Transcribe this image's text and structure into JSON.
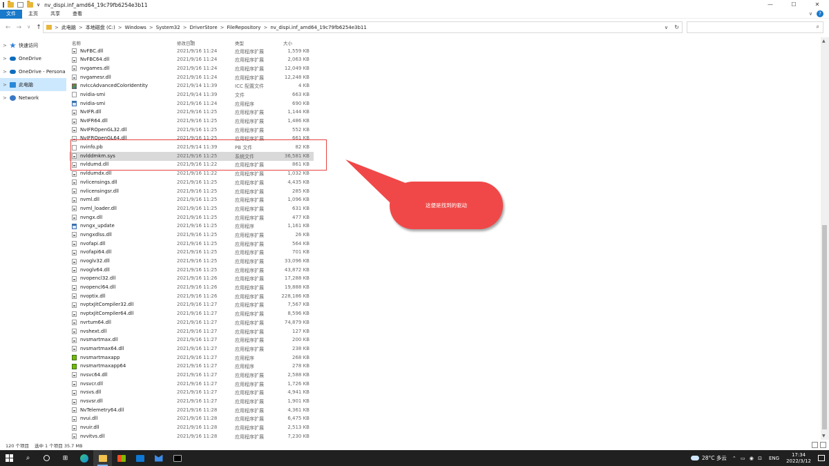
{
  "window": {
    "title": "nv_dispi.inf_amd64_19c79fb6254e3b11",
    "qa_dropdown": "∨",
    "controls": {
      "minimize": "—",
      "maximize": "☐",
      "close": "✕"
    }
  },
  "ribbon": {
    "tabs": [
      "文件",
      "主页",
      "共享",
      "查看"
    ],
    "collapse": "∨",
    "help": "?"
  },
  "nav_buttons": {
    "back": "←",
    "forward": "→",
    "recent": "∨",
    "up": "↑"
  },
  "address": {
    "crumbs": [
      "此电脑",
      "本地磁盘 (C:)",
      "Windows",
      "System32",
      "DriverStore",
      "FileRepository",
      "nv_dispi.inf_amd64_19c79fb6254e3b11"
    ],
    "separator": ">",
    "dropdown": "∨",
    "refresh": "↻"
  },
  "search": {
    "placeholder": "",
    "icon": "⌕"
  },
  "sidebar": {
    "items": [
      {
        "label": "快速访问",
        "icon": "star-icon"
      },
      {
        "label": "OneDrive",
        "icon": "cloud-icon"
      },
      {
        "label": "OneDrive - Persona",
        "icon": "cloud-icon"
      },
      {
        "label": "此电脑",
        "icon": "computer-icon",
        "selected": true
      },
      {
        "label": "Network",
        "icon": "network-icon"
      }
    ],
    "chevron": ">"
  },
  "columns": {
    "name": "名称",
    "date": "修改日期",
    "type": "类型",
    "size": "大小",
    "sort_caret": "^"
  },
  "files": [
    {
      "name": "NvFBC.dll",
      "date": "2021/9/16 11:24",
      "type": "应用程序扩展",
      "size": "1,559 KB",
      "icon": "dll"
    },
    {
      "name": "NvFBC64.dll",
      "date": "2021/9/16 11:24",
      "type": "应用程序扩展",
      "size": "2,063 KB",
      "icon": "dll"
    },
    {
      "name": "nvgames.dll",
      "date": "2021/9/16 11:24",
      "type": "应用程序扩展",
      "size": "12,049 KB",
      "icon": "dll"
    },
    {
      "name": "nvgamesr.dll",
      "date": "2021/9/16 11:24",
      "type": "应用程序扩展",
      "size": "12,248 KB",
      "icon": "dll"
    },
    {
      "name": "nvIccAdvancedColorIdentity",
      "date": "2021/9/14 11:39",
      "type": "ICC 配置文件",
      "size": "4 KB",
      "icon": "icc"
    },
    {
      "name": "nvidia-smi",
      "date": "2021/9/14 11:39",
      "type": "文件",
      "size": "663 KB",
      "icon": "file"
    },
    {
      "name": "nvidia-smi",
      "date": "2021/9/16 11:24",
      "type": "应用程序",
      "size": "690 KB",
      "icon": "exe"
    },
    {
      "name": "NvIFR.dll",
      "date": "2021/9/16 11:25",
      "type": "应用程序扩展",
      "size": "1,144 KB",
      "icon": "dll"
    },
    {
      "name": "NvIFR64.dll",
      "date": "2021/9/16 11:25",
      "type": "应用程序扩展",
      "size": "1,486 KB",
      "icon": "dll"
    },
    {
      "name": "NvIFROpenGL32.dll",
      "date": "2021/9/16 11:25",
      "type": "应用程序扩展",
      "size": "552 KB",
      "icon": "dll"
    },
    {
      "name": "NvIFROpenGL64.dll",
      "date": "2021/9/16 11:25",
      "type": "应用程序扩展",
      "size": "661 KB",
      "icon": "dll"
    },
    {
      "name": "nvinfo.pb",
      "date": "2021/9/14 11:39",
      "type": "PB 文件",
      "size": "82 KB",
      "icon": "file"
    },
    {
      "name": "nvlddmkm.sys",
      "date": "2021/9/16 11:25",
      "type": "系统文件",
      "size": "36,581 KB",
      "icon": "dll",
      "selected": true
    },
    {
      "name": "nvldumd.dll",
      "date": "2021/9/16 11:22",
      "type": "应用程序扩展",
      "size": "861 KB",
      "icon": "dll"
    },
    {
      "name": "nvldumdx.dll",
      "date": "2021/9/16 11:22",
      "type": "应用程序扩展",
      "size": "1,032 KB",
      "icon": "dll"
    },
    {
      "name": "nvlicensings.dll",
      "date": "2021/9/16 11:25",
      "type": "应用程序扩展",
      "size": "4,435 KB",
      "icon": "dll"
    },
    {
      "name": "nvlicensingsr.dll",
      "date": "2021/9/16 11:25",
      "type": "应用程序扩展",
      "size": "285 KB",
      "icon": "dll"
    },
    {
      "name": "nvml.dll",
      "date": "2021/9/16 11:25",
      "type": "应用程序扩展",
      "size": "1,096 KB",
      "icon": "dll"
    },
    {
      "name": "nvml_loader.dll",
      "date": "2021/9/16 11:25",
      "type": "应用程序扩展",
      "size": "631 KB",
      "icon": "dll"
    },
    {
      "name": "nvngx.dll",
      "date": "2021/9/16 11:25",
      "type": "应用程序扩展",
      "size": "477 KB",
      "icon": "dll"
    },
    {
      "name": "nvngx_update",
      "date": "2021/9/16 11:25",
      "type": "应用程序",
      "size": "1,161 KB",
      "icon": "exe"
    },
    {
      "name": "nvngxdlss.dll",
      "date": "2021/9/16 11:25",
      "type": "应用程序扩展",
      "size": "26 KB",
      "icon": "dll"
    },
    {
      "name": "nvofapi.dll",
      "date": "2021/9/16 11:25",
      "type": "应用程序扩展",
      "size": "564 KB",
      "icon": "dll"
    },
    {
      "name": "nvofapi64.dll",
      "date": "2021/9/16 11:25",
      "type": "应用程序扩展",
      "size": "701 KB",
      "icon": "dll"
    },
    {
      "name": "nvoglv32.dll",
      "date": "2021/9/16 11:25",
      "type": "应用程序扩展",
      "size": "33,096 KB",
      "icon": "dll"
    },
    {
      "name": "nvoglv64.dll",
      "date": "2021/9/16 11:25",
      "type": "应用程序扩展",
      "size": "43,872 KB",
      "icon": "dll"
    },
    {
      "name": "nvopencl32.dll",
      "date": "2021/9/16 11:26",
      "type": "应用程序扩展",
      "size": "17,288 KB",
      "icon": "dll"
    },
    {
      "name": "nvopencl64.dll",
      "date": "2021/9/16 11:26",
      "type": "应用程序扩展",
      "size": "19,888 KB",
      "icon": "dll"
    },
    {
      "name": "nvoptix.dll",
      "date": "2021/9/16 11:26",
      "type": "应用程序扩展",
      "size": "228,186 KB",
      "icon": "dll"
    },
    {
      "name": "nvptxJitCompiler32.dll",
      "date": "2021/9/16 11:27",
      "type": "应用程序扩展",
      "size": "7,567 KB",
      "icon": "dll"
    },
    {
      "name": "nvptxJitCompiler64.dll",
      "date": "2021/9/16 11:27",
      "type": "应用程序扩展",
      "size": "8,596 KB",
      "icon": "dll"
    },
    {
      "name": "nvrtum64.dll",
      "date": "2021/9/16 11:27",
      "type": "应用程序扩展",
      "size": "74,879 KB",
      "icon": "dll"
    },
    {
      "name": "nvshext.dll",
      "date": "2021/9/16 11:27",
      "type": "应用程序扩展",
      "size": "127 KB",
      "icon": "dll"
    },
    {
      "name": "nvsmartmax.dll",
      "date": "2021/9/16 11:27",
      "type": "应用程序扩展",
      "size": "200 KB",
      "icon": "dll"
    },
    {
      "name": "nvsmartmax64.dll",
      "date": "2021/9/16 11:27",
      "type": "应用程序扩展",
      "size": "238 KB",
      "icon": "dll"
    },
    {
      "name": "nvsmartmaxapp",
      "date": "2021/9/16 11:27",
      "type": "应用程序",
      "size": "268 KB",
      "icon": "nv"
    },
    {
      "name": "nvsmartmaxapp64",
      "date": "2021/9/16 11:27",
      "type": "应用程序",
      "size": "278 KB",
      "icon": "nv"
    },
    {
      "name": "nvsvc64.dll",
      "date": "2021/9/16 11:27",
      "type": "应用程序扩展",
      "size": "2,588 KB",
      "icon": "dll"
    },
    {
      "name": "nvsvcr.dll",
      "date": "2021/9/16 11:27",
      "type": "应用程序扩展",
      "size": "1,726 KB",
      "icon": "dll"
    },
    {
      "name": "nvsvs.dll",
      "date": "2021/9/16 11:27",
      "type": "应用程序扩展",
      "size": "4,941 KB",
      "icon": "dll"
    },
    {
      "name": "nvsvsr.dll",
      "date": "2021/9/16 11:27",
      "type": "应用程序扩展",
      "size": "1,901 KB",
      "icon": "dll"
    },
    {
      "name": "NvTelemetry64.dll",
      "date": "2021/9/16 11:28",
      "type": "应用程序扩展",
      "size": "4,361 KB",
      "icon": "dll"
    },
    {
      "name": "nvui.dll",
      "date": "2021/9/16 11:28",
      "type": "应用程序扩展",
      "size": "6,475 KB",
      "icon": "dll"
    },
    {
      "name": "nvuir.dll",
      "date": "2021/9/16 11:28",
      "type": "应用程序扩展",
      "size": "2,513 KB",
      "icon": "dll"
    },
    {
      "name": "nvvitvs.dll",
      "date": "2021/9/16 11:28",
      "type": "应用程序扩展",
      "size": "7,230 KB",
      "icon": "dll"
    }
  ],
  "annotation": {
    "callout_text": "这便是找到的驱动",
    "color": "#f04848"
  },
  "status": {
    "count": "120 个项目",
    "selection": "选中 1 个项目  35.7 MB"
  },
  "scrollbar": {
    "up": "▲",
    "down": "▼"
  },
  "taskbar": {
    "icons": [
      "windows-logo-icon",
      "search-icon",
      "task-view-icon",
      "widgets-icon",
      "edge-icon",
      "file-explorer-icon",
      "store-icon",
      "mail-icon",
      "app-icon",
      "terminal-icon"
    ],
    "weather": "28°C  多云",
    "tray_icons": "⌃ ▭ ◉ ⊡",
    "ime": "ENG",
    "time": "17:34",
    "date": "2022/3/12"
  }
}
